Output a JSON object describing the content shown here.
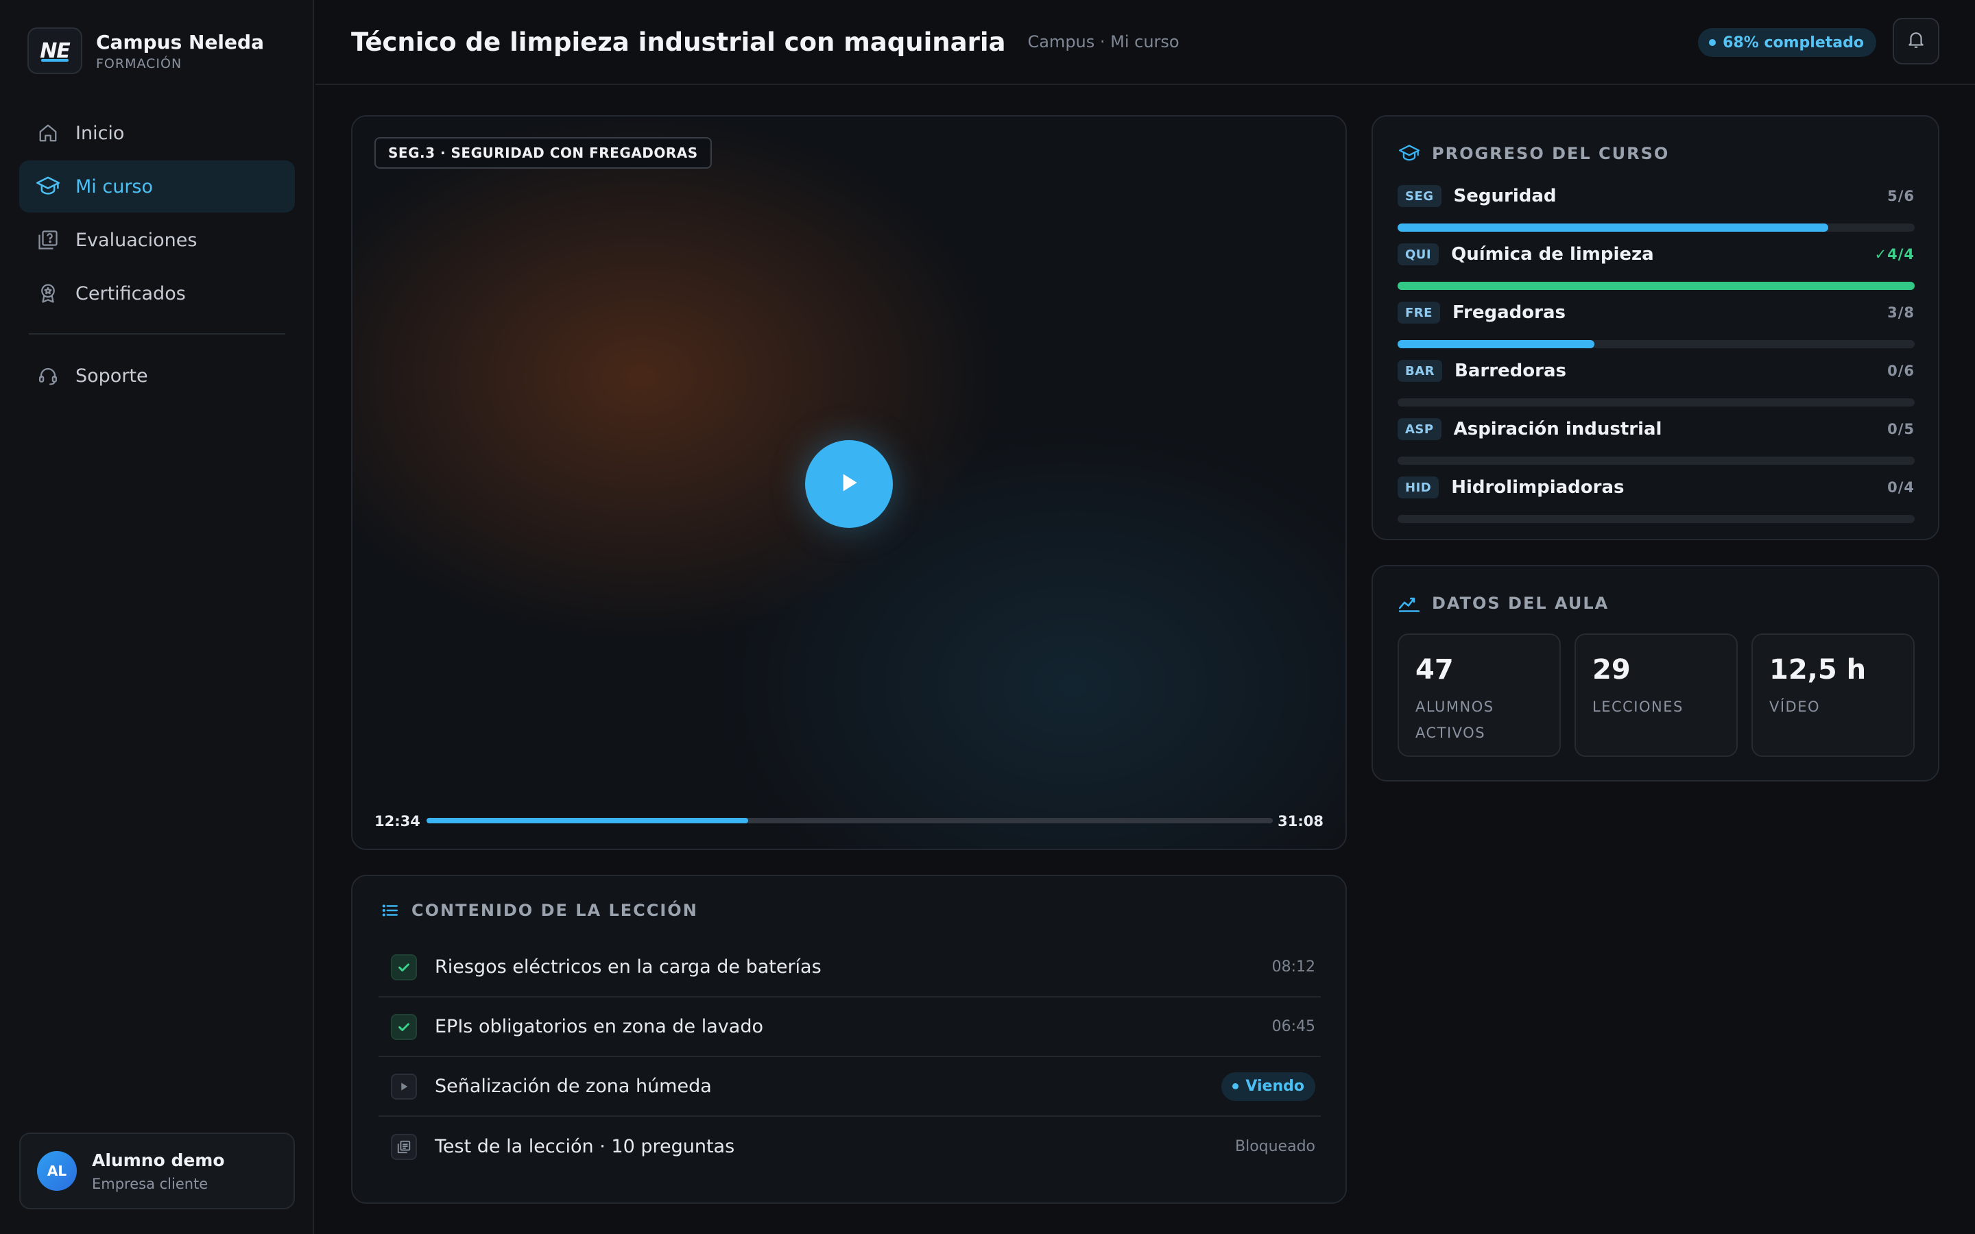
{
  "brand": {
    "logo_text": "NE",
    "name": "Campus Neleda",
    "subtitle": "FORMACIÓN"
  },
  "nav": {
    "items": [
      {
        "label": "Inicio",
        "icon": "home-icon",
        "active": false
      },
      {
        "label": "Mi curso",
        "icon": "graduation-cap-icon",
        "active": true
      },
      {
        "label": "Evaluaciones",
        "icon": "quiz-icon",
        "active": false
      },
      {
        "label": "Certificados",
        "icon": "award-icon",
        "active": false
      }
    ],
    "support": {
      "label": "Soporte",
      "icon": "headset-icon"
    }
  },
  "user": {
    "initials": "AL",
    "name": "Alumno demo",
    "role": "Empresa cliente"
  },
  "header": {
    "title": "Técnico de limpieza industrial con maquinaria",
    "breadcrumb": "Campus · Mi curso",
    "progress_badge": "68% completado"
  },
  "video": {
    "tag": "SEG.3 · SEGURIDAD CON FREGADORAS",
    "current_time": "12:34",
    "total_time": "31:08",
    "progress": 0.38
  },
  "lesson": {
    "heading": "CONTENIDO DE LA LECCIÓN",
    "items": [
      {
        "title": "Riesgos eléctricos en la carga de baterías",
        "status": "done",
        "meta": "08:12"
      },
      {
        "title": "EPIs obligatorios en zona de lavado",
        "status": "done",
        "meta": "06:45"
      },
      {
        "title": "Señalización de zona húmeda",
        "status": "watching",
        "meta": "Viendo"
      },
      {
        "title": "Test de la lección · 10 preguntas",
        "status": "locked",
        "meta": "Bloqueado"
      }
    ]
  },
  "course_progress": {
    "heading": "PROGRESO DEL CURSO",
    "modules": [
      {
        "code": "SEG",
        "name": "Seguridad",
        "count": "5/6",
        "fraction": 0.833,
        "complete": false
      },
      {
        "code": "QUI",
        "name": "Química de limpieza",
        "count": "✓4/4",
        "fraction": 1.0,
        "complete": true
      },
      {
        "code": "FRE",
        "name": "Fregadoras",
        "count": "3/8",
        "fraction": 0.38,
        "complete": false
      },
      {
        "code": "BAR",
        "name": "Barredoras",
        "count": "0/6",
        "fraction": 0,
        "complete": false
      },
      {
        "code": "ASP",
        "name": "Aspiración industrial",
        "count": "0/5",
        "fraction": 0,
        "complete": false
      },
      {
        "code": "HID",
        "name": "Hidrolimpiadoras",
        "count": "0/4",
        "fraction": 0,
        "complete": false
      }
    ]
  },
  "classroom": {
    "heading": "DATOS DEL AULA",
    "stats": [
      {
        "value": "47",
        "label_line1": "ALUMNOS",
        "label_line2": "ACTIVOS"
      },
      {
        "value": "29",
        "label_line1": "LECCIONES",
        "label_line2": ""
      },
      {
        "value": "12,5 h",
        "label_line1": "VÍDEO",
        "label_line2": ""
      }
    ]
  },
  "colors": {
    "accent": "#3ab4f2",
    "success": "#32c987",
    "background": "#0d0f13"
  }
}
